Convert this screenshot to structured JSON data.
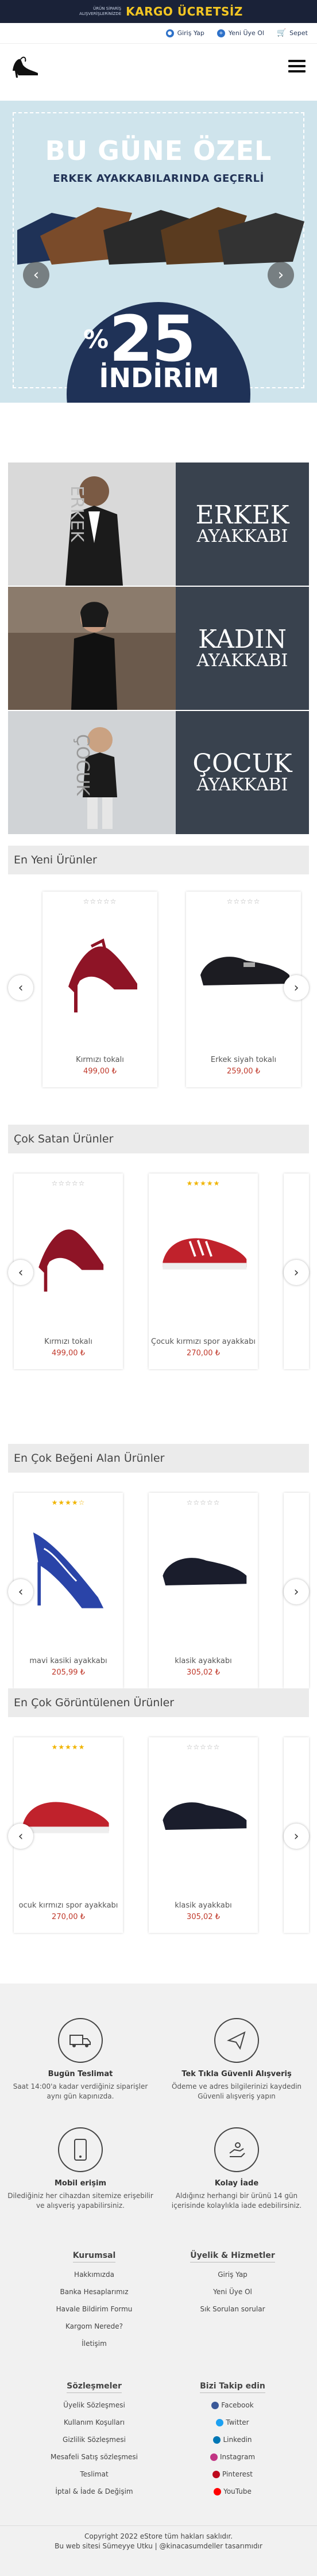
{
  "promo": {
    "line1": "ÜRÜN SİPARİŞ",
    "line2": "ALIŞVERİŞLERİNİZDE",
    "headline": "KARGO ÜCRETSİZ"
  },
  "toplinks": {
    "login": "Giriş Yap",
    "register": "Yeni Üye Ol",
    "cart": "Sepet"
  },
  "slider": {
    "title": "BU GÜNE ÖZEL",
    "subtitle": "ERKEK AYAKKABILARINDA GEÇERLİ",
    "percent": "%",
    "amount": "25",
    "discount": "İNDİRİM"
  },
  "categories": [
    {
      "title": "ERKEK",
      "sub": "AYAKKABI",
      "side": "ERKEK"
    },
    {
      "title": "KADIN",
      "sub": "AYAKKABI",
      "side": ""
    },
    {
      "title": "ÇOCUK",
      "sub": "AYAKKABI",
      "side": "ÇOCUK"
    }
  ],
  "sections": [
    {
      "title": "En Yeni Ürünler",
      "products": [
        {
          "name": "Kırmızı tokalı",
          "price": "499,00 ₺",
          "stars": "☆☆☆☆☆",
          "rating": 0
        },
        {
          "name": "Erkek siyah tokalı",
          "price": "259,00 ₺",
          "stars": "☆☆☆☆☆",
          "rating": 0
        }
      ]
    },
    {
      "title": "Çok Satan Ürünler",
      "products": [
        {
          "name": "Kırmızı tokalı",
          "price": "499,00 ₺",
          "stars": "☆☆☆☆☆",
          "rating": 0
        },
        {
          "name": "Çocuk kırmızı spor ayakkabı",
          "price": "270,00 ₺",
          "stars": "★★★★★",
          "rating": 5
        }
      ]
    },
    {
      "title": "En Çok Beğeni Alan Ürünler",
      "products": [
        {
          "name": "mavi kasiki ayakkabı",
          "price": "205,99 ₺",
          "stars": "★★★★☆",
          "rating": 4
        },
        {
          "name": "klasik ayakkabı",
          "price": "305,02 ₺",
          "stars": "☆☆☆☆☆",
          "rating": 0
        }
      ]
    },
    {
      "title": "En Çok Görüntülenen Ürünler",
      "products": [
        {
          "name": "ocuk kırmızı spor ayakkabı",
          "price": "270,00 ₺",
          "stars": "★★★★★",
          "rating": 5
        },
        {
          "name": "klasik ayakkabı",
          "price": "305,02 ₺",
          "stars": "☆☆☆☆☆",
          "rating": 0
        }
      ]
    }
  ],
  "features": [
    {
      "title": "Bugün Teslimat",
      "desc": "Saat 14:00'a kadar verdiğiniz siparişler aynı gün kapınızda."
    },
    {
      "title": "Tek Tıkla Güvenli Alışveriş",
      "desc": "Ödeme ve adres bilgilerinizi kaydedin Güvenli alışveriş yapın"
    },
    {
      "title": "Mobil erişim",
      "desc": "Dilediğiniz her cihazdan sitemize erişebilir ve alışveriş yapabilirsiniz."
    },
    {
      "title": "Kolay İade",
      "desc": "Aldığınız herhangi bir ürünü 14 gün içerisinde kolaylıkla iade edebilirsiniz."
    }
  ],
  "footer": {
    "corporate_title": "Kurumsal",
    "corporate": [
      "Hakkımızda",
      "Banka Hesaplarımız",
      "Havale Bildirim Formu",
      "Kargom Nerede?",
      "İletişim"
    ],
    "membership_title": "Üyelik & Hizmetler",
    "membership": [
      "Giriş Yap",
      "Yeni Üye Ol",
      "Sık Sorulan sorular"
    ],
    "contracts_title": "Sözleşmeler",
    "contracts": [
      "Üyelik Sözleşmesi",
      "Kullanım Koşulları",
      "Gizlilik Sözleşmesi",
      "Mesafeli Satış sözleşmesi",
      "Teslimat",
      "İptal & İade & Değişim"
    ],
    "social_title": "Bizi Takip edin",
    "social": [
      {
        "label": "Facebook",
        "color": "#3b5998"
      },
      {
        "label": "Twitter",
        "color": "#1da1f2"
      },
      {
        "label": "Linkedin",
        "color": "#0077b5"
      },
      {
        "label": "Instagram",
        "color": "#c13584"
      },
      {
        "label": "Pinterest",
        "color": "#bd081c"
      },
      {
        "label": "YouTube",
        "color": "#ff0000"
      }
    ],
    "copyright": "Copyright 2022 eStore tüm hakları saklıdır.",
    "credit": "Bu web sitesi Sümeyye Utku | @kinacasumdeller tasarımıdır"
  }
}
